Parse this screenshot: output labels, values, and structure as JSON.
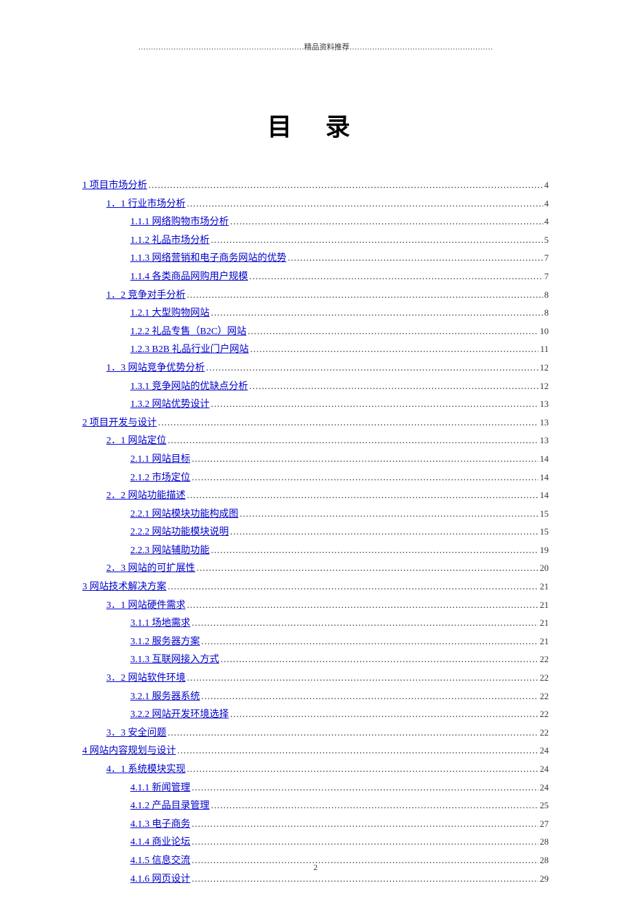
{
  "header_text": "…………………………………………………………精品资料推荐…………………………………………………",
  "title": "目  录",
  "footer_page": "2",
  "toc": [
    {
      "level": 1,
      "label": "1  项目市场分析",
      "page": "4"
    },
    {
      "level": 2,
      "label": "1．1  行业市场分析",
      "page": "4"
    },
    {
      "level": 3,
      "label": "1.1.1  网络购物市场分析",
      "page": "4"
    },
    {
      "level": 3,
      "label": "1.1.2  礼品市场分析",
      "page": "5"
    },
    {
      "level": 3,
      "label": "1.1.3  网络营销和电子商务网站的优势",
      "page": "7"
    },
    {
      "level": 3,
      "label": "1.1.4  各类商品网购用户规模",
      "page": "7"
    },
    {
      "level": 2,
      "label": "1．2  竞争对手分析",
      "page": "8"
    },
    {
      "level": 3,
      "label": "1.2.1  大型购物网站",
      "page": "8"
    },
    {
      "level": 3,
      "label": "1.2.2  礼品专售（B2C）网站",
      "page": "10"
    },
    {
      "level": 3,
      "label": "1.2.3 B2B 礼品行业门户网站",
      "page": "11"
    },
    {
      "level": 2,
      "label": "1．3  网站竞争优势分析",
      "page": "12"
    },
    {
      "level": 3,
      "label": "1.3.1  竞争网站的优缺点分析",
      "page": "12"
    },
    {
      "level": 3,
      "label": "1.3.2  网站优势设计",
      "page": "13"
    },
    {
      "level": 1,
      "label": "2  项目开发与设计",
      "page": "13"
    },
    {
      "level": 2,
      "label": "2．1  网站定位",
      "page": "13"
    },
    {
      "level": 3,
      "label": "2.1.1  网站目标",
      "page": "14"
    },
    {
      "level": 3,
      "label": "2.1.2  市场定位",
      "page": "14"
    },
    {
      "level": 2,
      "label": "2．2  网站功能描述",
      "page": "14"
    },
    {
      "level": 3,
      "label": "2.2.1  网站模块功能构成图",
      "page": "15"
    },
    {
      "level": 3,
      "label": "2.2.2  网站功能模块说明",
      "page": "15"
    },
    {
      "level": 3,
      "label": "2.2.3  网站辅助功能",
      "page": "19"
    },
    {
      "level": 2,
      "label": "2．3  网站的可扩展性",
      "page": "20"
    },
    {
      "level": 1,
      "label": "3  网站技术解决方案",
      "page": "21"
    },
    {
      "level": 2,
      "label": "3．1  网站硬件需求",
      "page": "21"
    },
    {
      "level": 3,
      "label": "3.1.1  场地需求",
      "page": "21"
    },
    {
      "level": 3,
      "label": "3.1.2  服务器方案",
      "page": "21"
    },
    {
      "level": 3,
      "label": "3.1.3  互联网接入方式",
      "page": "22"
    },
    {
      "level": 2,
      "label": "3．2  网站软件环境",
      "page": "22"
    },
    {
      "level": 3,
      "label": "3.2.1  服务器系统",
      "page": "22"
    },
    {
      "level": 3,
      "label": "3.2.2  网站开发环境选择",
      "page": "22"
    },
    {
      "level": 2,
      "label": "3．3  安全问题",
      "page": "22"
    },
    {
      "level": 1,
      "label": "4  网站内容规划与设计",
      "page": "24"
    },
    {
      "level": 2,
      "label": "4．1  系统模块实现",
      "page": "24"
    },
    {
      "level": 3,
      "label": "4.1.1  新闻管理",
      "page": "24"
    },
    {
      "level": 3,
      "label": "4.1.2  产品目录管理",
      "page": "25"
    },
    {
      "level": 3,
      "label": "4.1.3  电子商务",
      "page": "27"
    },
    {
      "level": 3,
      "label": "4.1.4  商业论坛",
      "page": "28"
    },
    {
      "level": 3,
      "label": "4.1.5  信息交流",
      "page": "28"
    },
    {
      "level": 3,
      "label": "4.1.6  网页设计",
      "page": "29"
    }
  ]
}
